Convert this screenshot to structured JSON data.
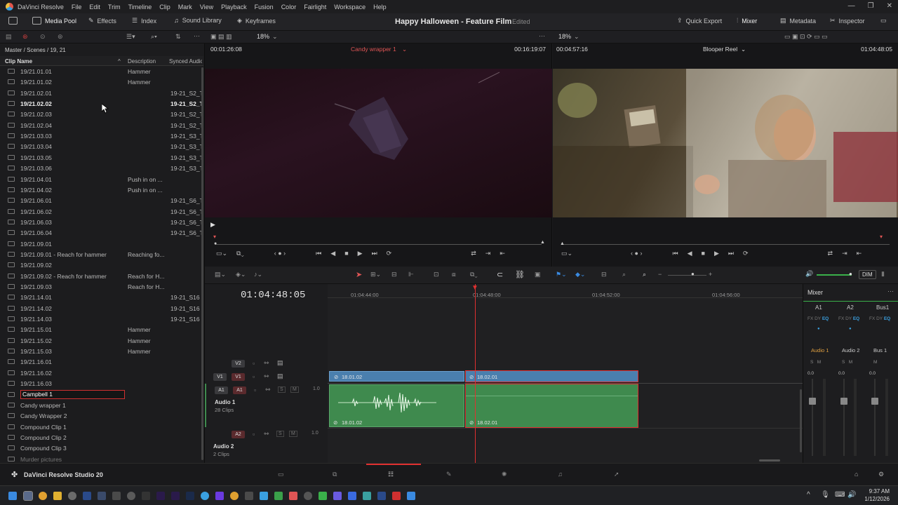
{
  "menu": {
    "app_title": "DaVinci Resolve",
    "items": [
      "File",
      "Edit",
      "Trim",
      "Timeline",
      "Clip",
      "Mark",
      "View",
      "Playback",
      "Fusion",
      "Color",
      "Fairlight",
      "Workspace",
      "Help"
    ]
  },
  "toolbar": {
    "media_pool": "Media Pool",
    "effects": "Effects",
    "index": "Index",
    "sound_library": "Sound Library",
    "keyframes": "Keyframes",
    "project_title": "Happy Halloween - Feature Film",
    "project_status": "Edited",
    "quick_export": "Quick Export",
    "mixer": "Mixer",
    "metadata": "Metadata",
    "inspector": "Inspector"
  },
  "zoom": {
    "source": "18%",
    "timeline": "18%"
  },
  "pool": {
    "breadcrumb": "Master / Scenes / 19, 21",
    "columns": {
      "name": "Clip Name",
      "description": "Description",
      "synced": "Synced Audio"
    },
    "rows": [
      {
        "name": "19/21.01.01",
        "desc": "Hammer",
        "sync": ""
      },
      {
        "name": "19/21.01.02",
        "desc": "Hammer",
        "sync": ""
      },
      {
        "name": "19/21.02.01",
        "desc": "",
        "sync": "19-21_S2_T"
      },
      {
        "name": "19/21.02.02",
        "desc": "",
        "sync": "19-21_S2_T"
      },
      {
        "name": "19/21.02.03",
        "desc": "",
        "sync": "19-21_S2_T"
      },
      {
        "name": "19/21.02.04",
        "desc": "",
        "sync": "19-21_S2_T"
      },
      {
        "name": "19/21.03.03",
        "desc": "",
        "sync": "19-21_S3_T"
      },
      {
        "name": "19/21.03.04",
        "desc": "",
        "sync": "19-21_S3_T"
      },
      {
        "name": "19/21.03.05",
        "desc": "",
        "sync": "19-21_S3_T"
      },
      {
        "name": "19/21.03.06",
        "desc": "",
        "sync": "19-21_S3_T"
      },
      {
        "name": "19/21.04.01",
        "desc": "Push in on ...",
        "sync": ""
      },
      {
        "name": "19/21.04.02",
        "desc": "Push in on ...",
        "sync": ""
      },
      {
        "name": "19/21.06.01",
        "desc": "",
        "sync": "19-21_S6_T"
      },
      {
        "name": "19/21.06.02",
        "desc": "",
        "sync": "19-21_S6_T"
      },
      {
        "name": "19/21.06.03",
        "desc": "",
        "sync": "19-21_S6_T"
      },
      {
        "name": "19/21.06.04",
        "desc": "",
        "sync": "19-21_S6_T"
      },
      {
        "name": "19/21.09.01",
        "desc": "",
        "sync": ""
      },
      {
        "name": "19/21.09.01 - Reach for hammer",
        "desc": "Reaching fo...",
        "sync": ""
      },
      {
        "name": "19/21.09.02",
        "desc": "",
        "sync": ""
      },
      {
        "name": "19/21.09.02 - Reach for hammer",
        "desc": "Reach for H...",
        "sync": ""
      },
      {
        "name": "19/21.09.03",
        "desc": "Reach for H...",
        "sync": ""
      },
      {
        "name": "19/21.14.01",
        "desc": "",
        "sync": "19-21_S16"
      },
      {
        "name": "19/21.14.02",
        "desc": "",
        "sync": "19-21_S16"
      },
      {
        "name": "19/21.14.03",
        "desc": "",
        "sync": "19-21_S16"
      },
      {
        "name": "19/21.15.01",
        "desc": "Hammer",
        "sync": ""
      },
      {
        "name": "19/21.15.02",
        "desc": "Hammer",
        "sync": ""
      },
      {
        "name": "19/21.15.03",
        "desc": "Hammer",
        "sync": ""
      },
      {
        "name": "19/21.16.01",
        "desc": "",
        "sync": ""
      },
      {
        "name": "19/21.16.02",
        "desc": "",
        "sync": ""
      },
      {
        "name": "19/21.16.03",
        "desc": "",
        "sync": ""
      },
      {
        "name": "Campbell 1",
        "desc": "",
        "sync": ""
      },
      {
        "name": "Candy wrapper 1",
        "desc": "",
        "sync": ""
      },
      {
        "name": "Candy Wrapper 2",
        "desc": "",
        "sync": ""
      },
      {
        "name": "Compound Clip 1",
        "desc": "",
        "sync": ""
      },
      {
        "name": "Compound Clip 2",
        "desc": "",
        "sync": ""
      },
      {
        "name": "Compound Clip 3",
        "desc": "",
        "sync": ""
      },
      {
        "name": "Murder pictures",
        "desc": "",
        "sync": ""
      }
    ]
  },
  "source": {
    "timecode_left": "00:01:26:08",
    "clip": "Candy wrapper 1",
    "timecode_right": "00:16:19:07"
  },
  "program": {
    "timecode_left": "00:04:57:16",
    "timeline": "Blooper Reel",
    "timecode_right": "01:04:48:05"
  },
  "timeline": {
    "timecode": "01:04:48:05",
    "ruler": [
      "01:04:44:00",
      "01:04:48:00",
      "01:04:52:00",
      "01:04:56:00"
    ],
    "tracks": {
      "v2": "V2",
      "v1": "V1",
      "a1": "A1",
      "a2": "A2",
      "audio1_name": "Audio 1",
      "audio1_clips": "28 Clips",
      "audio2_name": "Audio 2",
      "audio2_clips": "2 Clips",
      "a1_level": "1.0",
      "a2_level": "1.0"
    },
    "clips": {
      "v_left": "18.01.02",
      "v_right": "18.02.01",
      "a_left": "18.01.02",
      "a_right": "18.02.01"
    }
  },
  "mixer": {
    "title": "Mixer",
    "channels": [
      "A1",
      "A2",
      "Bus1"
    ],
    "labels": [
      "Audio 1",
      "Audio 2",
      "Bus 1"
    ],
    "dim": "DIM",
    "levels": [
      "0.0",
      "0.0",
      "0.0"
    ]
  },
  "taskbar": {
    "app_name": "DaVinci Resolve Studio 20",
    "time": "9:37 AM",
    "date": "1/12/2026"
  },
  "colors": {
    "accent": "#e05555",
    "video_clip": "#4a7fae",
    "audio_clip": "#3f8a4e"
  }
}
